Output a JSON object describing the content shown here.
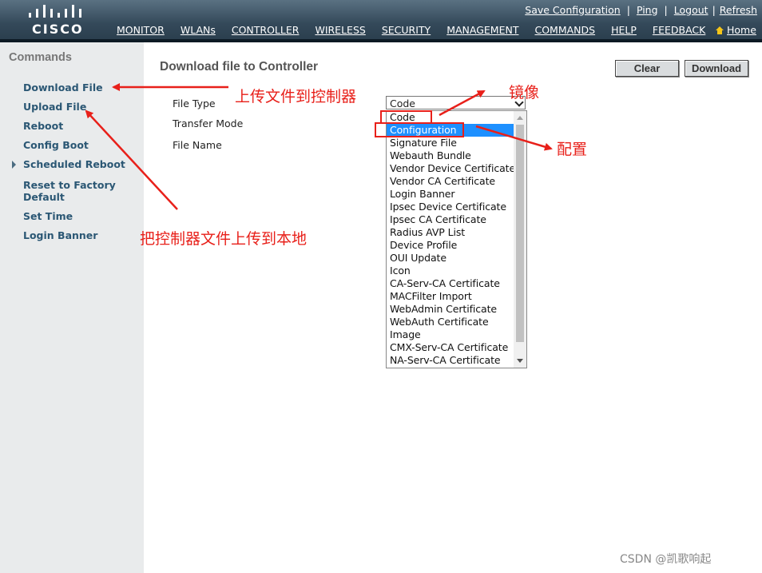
{
  "header": {
    "logo_text": "CISCO",
    "util_links": [
      "Save Configuration",
      "Ping",
      "Logout",
      "Refresh"
    ],
    "nav": [
      "MONITOR",
      "WLANs",
      "CONTROLLER",
      "WIRELESS",
      "SECURITY",
      "MANAGEMENT",
      "COMMANDS",
      "HELP",
      "FEEDBACK"
    ],
    "active_nav": "COMMANDS",
    "home_label": "Home"
  },
  "sidebar": {
    "title": "Commands",
    "items": [
      {
        "label": "Download File"
      },
      {
        "label": "Upload File"
      },
      {
        "label": "Reboot"
      },
      {
        "label": "Config Boot"
      },
      {
        "label": "Scheduled Reboot"
      },
      {
        "label": "Reset to Factory Default"
      },
      {
        "label": "Set Time"
      },
      {
        "label": "Login Banner"
      }
    ]
  },
  "main": {
    "title": "Download file to Controller",
    "buttons": {
      "clear": "Clear",
      "download": "Download"
    },
    "fields": {
      "file_type": "File Type",
      "transfer_mode": "Transfer Mode",
      "file_name": "File Name"
    },
    "file_type_value": "Code",
    "file_type_options": [
      "Code",
      "Configuration",
      "Signature File",
      "Webauth Bundle",
      "Vendor Device Certificate",
      "Vendor CA Certificate",
      "Login Banner",
      "Ipsec Device Certificate",
      "Ipsec CA Certificate",
      "Radius AVP List",
      "Device Profile",
      "OUI Update",
      "Icon",
      "CA-Serv-CA Certificate",
      "MACFilter Import",
      "WebAdmin Certificate",
      "WebAuth Certificate",
      "Image",
      "CMX-Serv-CA Certificate",
      "NA-Serv-CA Certificate"
    ],
    "highlighted_option": "Configuration"
  },
  "annotations": {
    "upload_to_controller": "上传文件到控制器",
    "image": "镜像",
    "config": "配置",
    "upload_to_local": "把控制器文件上传到本地",
    "color": "#e8201a"
  },
  "watermark": "CSDN @凯歌响起"
}
